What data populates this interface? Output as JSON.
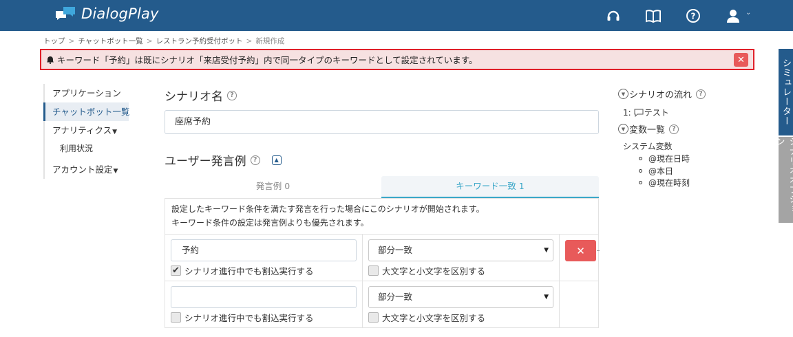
{
  "header": {
    "app_name": "DialogPlay",
    "icons": [
      "headset-icon",
      "book-icon",
      "help-circle-icon",
      "user-icon",
      "chevron-down-icon"
    ],
    "background": "#245b8c"
  },
  "breadcrumb": {
    "items": [
      "トップ",
      "チャットボット一覧",
      "レストラン予約受付ボット"
    ],
    "current": "新規作成",
    "separator": ">"
  },
  "alert": {
    "message": "キーワード「予約」は既にシナリオ「来店受付予約」内で同一タイプのキーワードとして設定されています。",
    "close_label": "✕"
  },
  "sidenav": {
    "items": [
      {
        "label": "アプリケーション"
      },
      {
        "label": "チャットボット一覧"
      },
      {
        "label": "アナリティクス"
      },
      {
        "label": "利用状況"
      },
      {
        "label": "アカウント設定"
      }
    ]
  },
  "main": {
    "scenario_name_title": "シナリオ名",
    "scenario_name_value": "座席予約",
    "user_utterance_title": "ユーザー発言例",
    "tabs": [
      {
        "label": "発言例 0"
      },
      {
        "label": "キーワード一致 1"
      }
    ],
    "description_line1": "設定したキーワード条件を満たす発言を行った場合にこのシナリオが開始されます。",
    "description_line2": "キーワード条件の設定は発言例よりも優先されます。",
    "keywords": [
      {
        "value": "予約",
        "match_type": "部分一致",
        "interrupt_label": "シナリオ進行中でも割込実行する",
        "interrupt_checked": true,
        "case_label": "大文字と小文字を区別する",
        "case_checked": false,
        "delete_label": "✕"
      },
      {
        "value": "",
        "match_type": "部分一致",
        "interrupt_label": "シナリオ進行中でも割込実行する",
        "interrupt_checked": false,
        "case_label": "大文字と小文字を区別する",
        "case_checked": false
      }
    ]
  },
  "rightpanel": {
    "flow_title": "シナリオの流れ",
    "flow_item_number": "1:",
    "flow_item_label": "テスト",
    "variables_title": "変数一覧",
    "system_variables_title": "システム変数",
    "variables": [
      "@現在日時",
      "@本日",
      "@現在時刻"
    ]
  },
  "side_tabs": {
    "simulator": "シミュレーター",
    "scenario_options": "シナリオオプション"
  }
}
